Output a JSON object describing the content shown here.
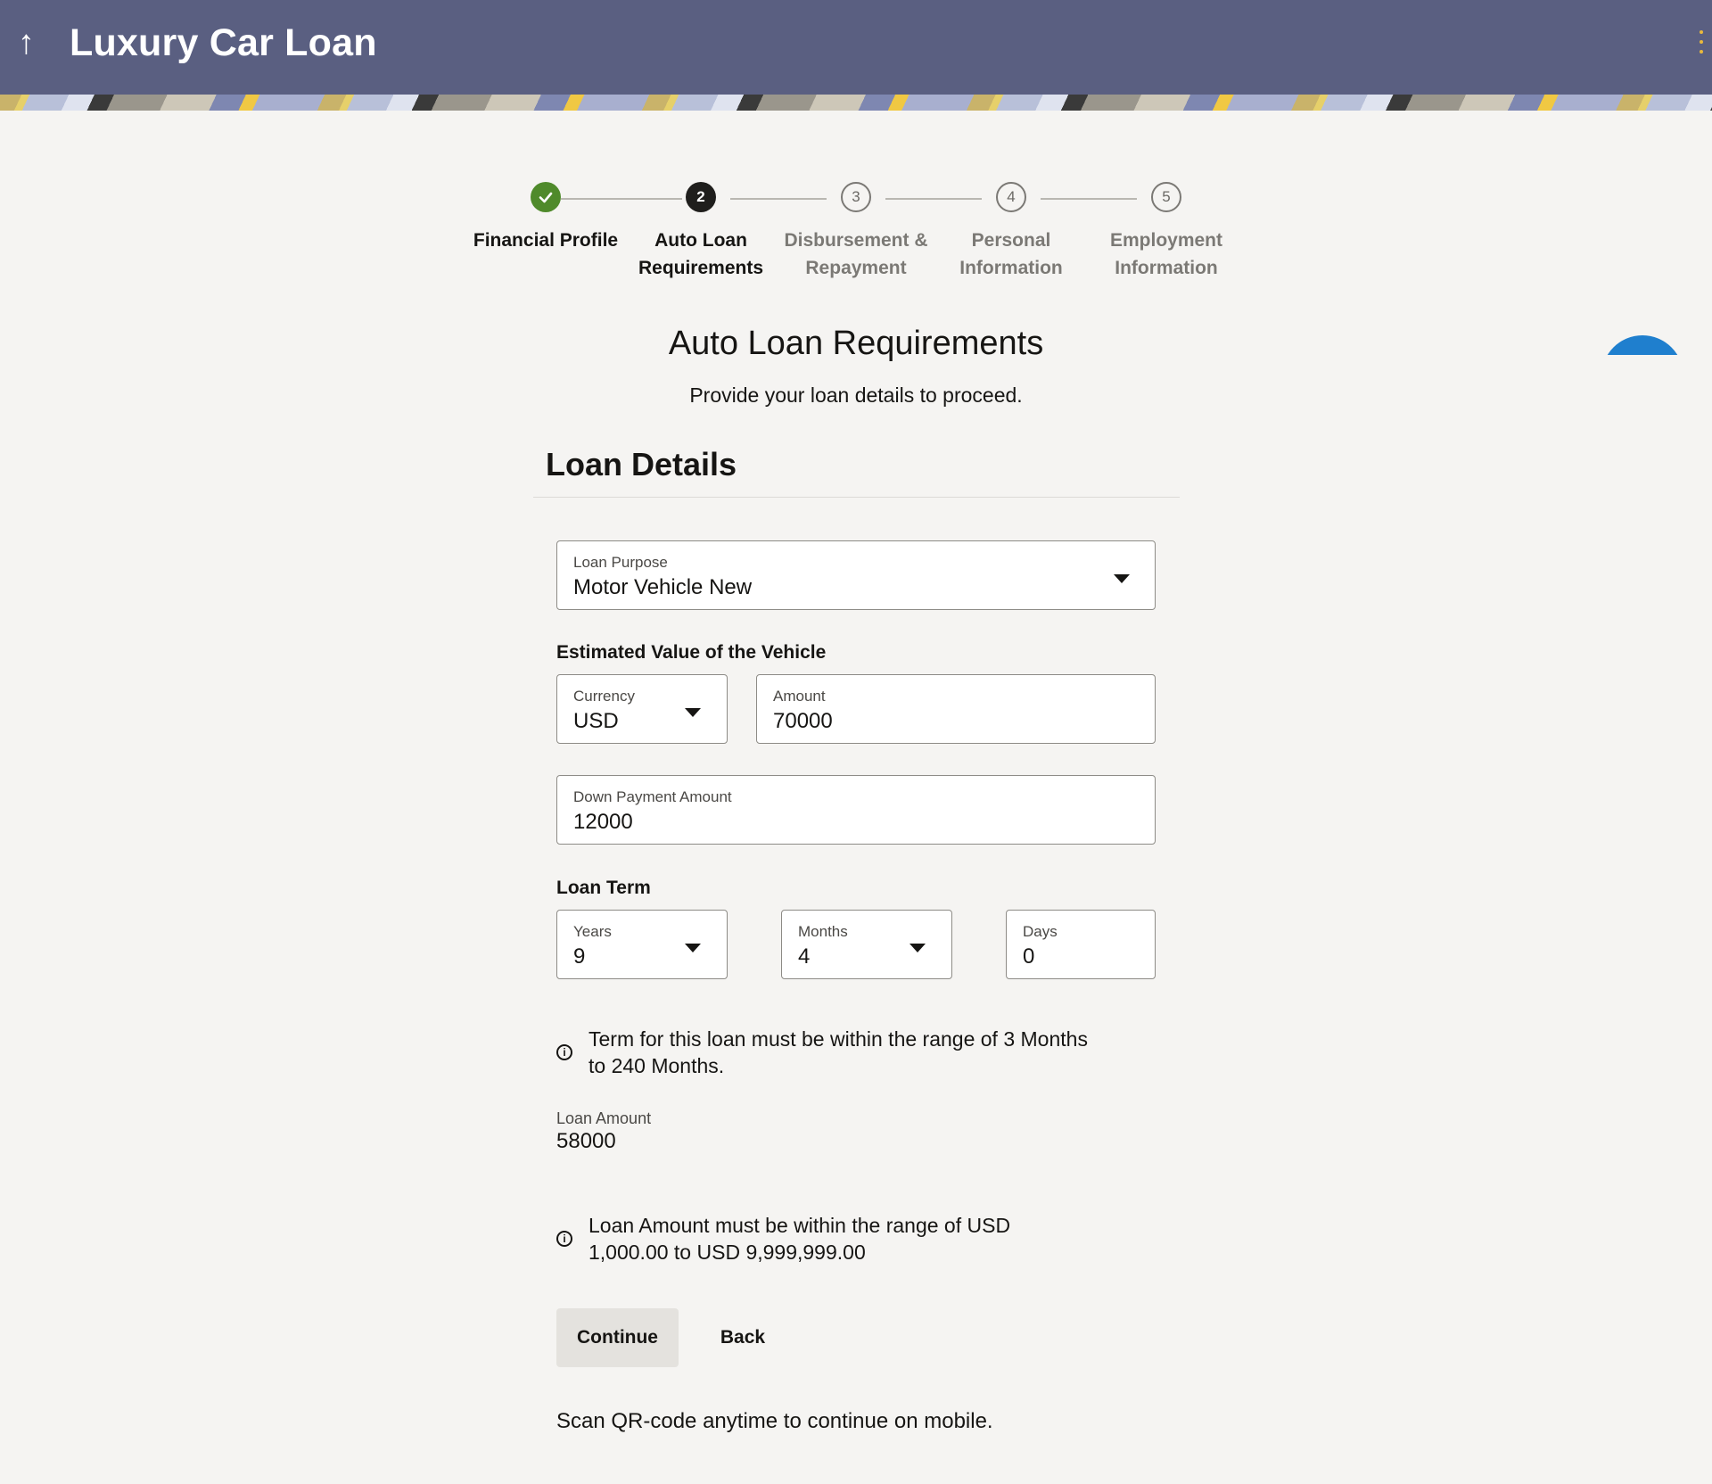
{
  "header": {
    "back_icon": "arrow-up-icon",
    "title": "Luxury Car Loan",
    "menu_icon": "kebab-menu-icon"
  },
  "stepper": {
    "steps": [
      {
        "number": "✓",
        "label_line1": "Financial Profile",
        "label_line2": "",
        "state": "done"
      },
      {
        "number": "2",
        "label_line1": "Auto Loan",
        "label_line2": "Requirements",
        "state": "current"
      },
      {
        "number": "3",
        "label_line1": "Disbursement &",
        "label_line2": "Repayment",
        "state": "todo"
      },
      {
        "number": "4",
        "label_line1": "Personal",
        "label_line2": "Information",
        "state": "todo"
      },
      {
        "number": "5",
        "label_line1": "Employment",
        "label_line2": "Information",
        "state": "todo"
      }
    ]
  },
  "page": {
    "title": "Auto Loan Requirements",
    "subtitle": "Provide your loan details to proceed.",
    "section_title": "Loan Details"
  },
  "form": {
    "loan_purpose": {
      "label": "Loan Purpose",
      "value": "Motor Vehicle New"
    },
    "vehicle_value_label": "Estimated Value of the Vehicle",
    "currency": {
      "label": "Currency",
      "value": "USD"
    },
    "amount": {
      "label": "Amount",
      "value": "70000"
    },
    "down_payment": {
      "label": "Down Payment Amount",
      "value": "12000"
    },
    "loan_term_label": "Loan Term",
    "years": {
      "label": "Years",
      "value": "9"
    },
    "months": {
      "label": "Months",
      "value": "4"
    },
    "days": {
      "label": "Days",
      "value": "0"
    },
    "term_info_line1": "Term for this loan must be within the range of 3 Months",
    "term_info_line2": "to 240 Months.",
    "loan_amount": {
      "label": "Loan Amount",
      "value": "58000"
    },
    "amount_info_line1": "Loan Amount must be within the range of USD",
    "amount_info_line2": "1,000.00 to USD 9,999,999.00"
  },
  "actions": {
    "continue_label": "Continue",
    "back_label": "Back"
  },
  "footer": {
    "qr_text": "Scan QR-code anytime to continue on mobile."
  },
  "colors": {
    "header_bg": "#5a5f81",
    "done_green": "#4f8a2b",
    "fab_blue": "#1f7fce"
  }
}
